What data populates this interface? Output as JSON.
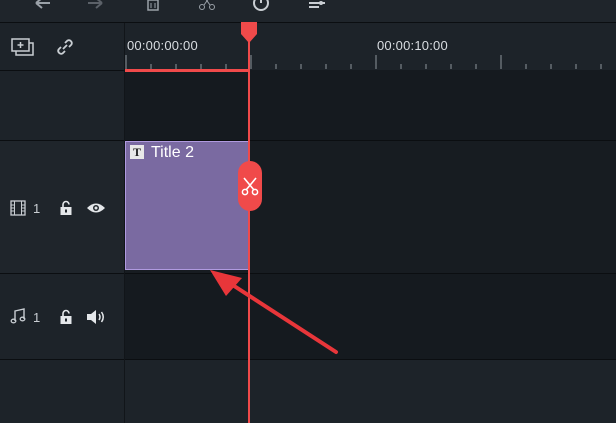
{
  "ruler": {
    "timecodes": [
      "00:00:00:00",
      "00:00:10:00"
    ]
  },
  "tracks": {
    "video": {
      "number": "1"
    },
    "audio": {
      "number": "1"
    }
  },
  "clip": {
    "tag": "T",
    "title": "Title 2",
    "fill_color": "#7a6aa1",
    "border_color": "#b09ae0"
  },
  "colors": {
    "playhead": "#f04a4a",
    "panel": "#1d2329",
    "background": "#151a1f"
  },
  "icons": {
    "toolbar": [
      "undo-icon",
      "redo-icon",
      "delete-icon",
      "split-icon",
      "timer-icon",
      "adjust-icon"
    ],
    "header": [
      "add-track-icon",
      "link-icon"
    ],
    "video_track": [
      "film-icon",
      "lock-icon",
      "eye-icon"
    ],
    "audio_track": [
      "music-note-icon",
      "lock-icon",
      "speaker-icon"
    ],
    "clip_tool": "scissors-icon"
  }
}
